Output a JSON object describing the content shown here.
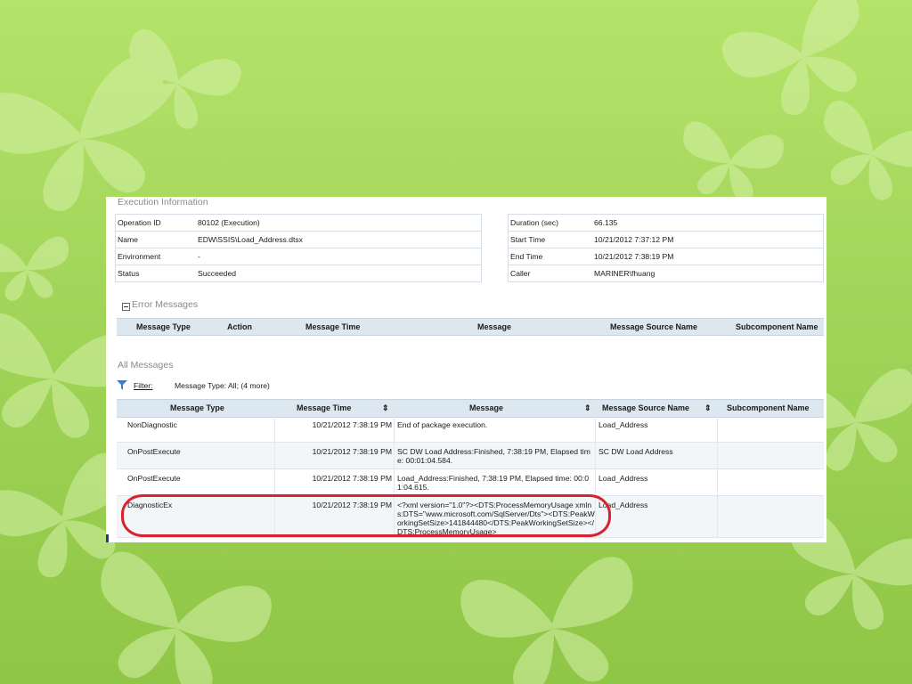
{
  "colors": {
    "background": "#a3d65a",
    "panel": "#ffffff",
    "header": "#dde7f0",
    "highlight": "#d8232f"
  },
  "execution_info": {
    "title": "Execution Information",
    "left": [
      {
        "key": "Operation ID",
        "value": "80102 (Execution)"
      },
      {
        "key": "Name",
        "value": "EDW\\SSIS\\Load_Address.dtsx"
      },
      {
        "key": "Environment",
        "value": "-"
      },
      {
        "key": "Status",
        "value": "Succeeded"
      }
    ],
    "right": [
      {
        "key": "Duration (sec)",
        "value": "66.135"
      },
      {
        "key": "Start Time",
        "value": "10/21/2012 7:37:12 PM"
      },
      {
        "key": "End Time",
        "value": "10/21/2012 7:38:19 PM"
      },
      {
        "key": "Caller",
        "value": "MARINER\\fhuang"
      }
    ]
  },
  "error_messages": {
    "title": "Error Messages",
    "columns": [
      "Message Type",
      "Action",
      "Message Time",
      "Message",
      "Message Source Name",
      "Subcomponent Name"
    ]
  },
  "all_messages": {
    "title": "All Messages",
    "filter_label": "Filter:",
    "filter_value": "Message Type: All;  (4 more)",
    "columns": [
      "Message Type",
      "Message Time",
      "Message",
      "Message Source Name",
      "Subcomponent Name"
    ],
    "rows": [
      {
        "type": "NonDiagnostic",
        "time": "10/21/2012 7:38:19 PM",
        "message": "End of package execution.",
        "source": "Load_Address",
        "sub": ""
      },
      {
        "type": "OnPostExecute",
        "time": "10/21/2012 7:38:19 PM",
        "message": "SC DW Load Address:Finished, 7:38:19 PM, Elapsed time: 00:01:04.584.",
        "source": "SC DW Load Address",
        "sub": ""
      },
      {
        "type": "OnPostExecute",
        "time": "10/21/2012 7:38:19 PM",
        "message": "Load_Address:Finished, 7:38:19 PM, Elapsed time: 00:01:04.615.",
        "source": "Load_Address",
        "sub": ""
      },
      {
        "type": "DiagnosticEx",
        "time": "10/21/2012 7:38:19 PM",
        "message": "<?xml version=\"1.0\"?><DTS:ProcessMemoryUsage xmlns:DTS=\"www.microsoft.com/SqlServer/Dts\"><DTS:PeakWorkingSetSize>141844480</DTS:PeakWorkingSetSize></DTS:ProcessMemoryUsage>",
        "source": "Load_Address",
        "sub": ""
      }
    ]
  }
}
